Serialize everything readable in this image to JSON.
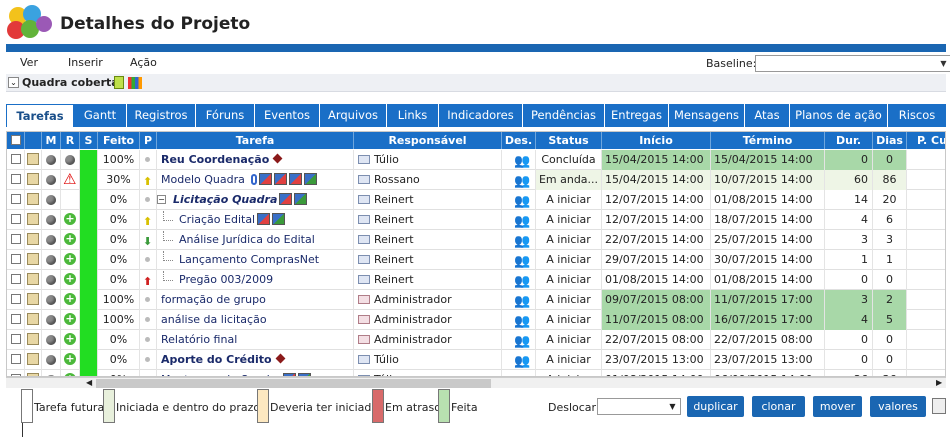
{
  "header": {
    "title": "Detalhes do Projeto"
  },
  "menu": {
    "items": [
      "Ver",
      "Inserir",
      "Ação"
    ],
    "baseline_label": "Baseline:",
    "baseline_value": ""
  },
  "project": {
    "name": "Quadra coberta"
  },
  "tabs": [
    "Tarefas",
    "Gantt",
    "Registros",
    "Fóruns",
    "Eventos",
    "Arquivos",
    "Links",
    "Indicadores",
    "Pendências",
    "Entregas",
    "Mensagens",
    "Atas",
    "Planos de ação",
    "Riscos"
  ],
  "active_tab": "Tarefas",
  "columns": [
    "M",
    "R",
    "S",
    "Feito",
    "P",
    "Tarefa",
    "Responsável",
    "Des.",
    "Status",
    "Início",
    "Término",
    "Dur.",
    "Dias",
    "P. Cu"
  ],
  "rows": [
    {
      "feito": "100%",
      "tarefa": "Reu Coordenação",
      "resp": "Túlio",
      "status": "Concluída",
      "inicio": "15/04/2015 14:00",
      "termino": "15/04/2015 14:00",
      "dur": "0",
      "dias": "0",
      "r": "dot",
      "p": "dot"
    },
    {
      "feito": "30%",
      "tarefa": "Modelo Quadra",
      "resp": "Rossano",
      "status": "Em anda...",
      "inicio": "15/04/2015 14:00",
      "termino": "10/07/2015 14:00",
      "dur": "60",
      "dias": "86",
      "r": "warn",
      "p": "up-yellow"
    },
    {
      "feito": "0%",
      "tarefa": "Licitação Quadra",
      "resp": "Reinert",
      "status": "A iniciar",
      "inicio": "12/07/2015 14:00",
      "termino": "01/08/2015 14:00",
      "dur": "14",
      "dias": "20",
      "r": "none",
      "p": "dot"
    },
    {
      "feito": "0%",
      "tarefa": "Criação Edital",
      "resp": "Reinert",
      "status": "A iniciar",
      "inicio": "12/07/2015 14:00",
      "termino": "18/07/2015 14:00",
      "dur": "4",
      "dias": "6",
      "r": "plus",
      "p": "up-yellow"
    },
    {
      "feito": "0%",
      "tarefa": "Análise Jurídica do Edital",
      "resp": "Reinert",
      "status": "A iniciar",
      "inicio": "22/07/2015 14:00",
      "termino": "25/07/2015 14:00",
      "dur": "3",
      "dias": "3",
      "r": "plus",
      "p": "down-green"
    },
    {
      "feito": "0%",
      "tarefa": "Lançamento ComprasNet",
      "resp": "Reinert",
      "status": "A iniciar",
      "inicio": "29/07/2015 14:00",
      "termino": "30/07/2015 14:00",
      "dur": "1",
      "dias": "1",
      "r": "plus",
      "p": "dot"
    },
    {
      "feito": "0%",
      "tarefa": "Pregão 003/2009",
      "resp": "Reinert",
      "status": "A iniciar",
      "inicio": "01/08/2015 14:00",
      "termino": "01/08/2015 14:00",
      "dur": "0",
      "dias": "0",
      "r": "plus",
      "p": "up-red"
    },
    {
      "feito": "100%",
      "tarefa": "formação de grupo",
      "resp": "Administrador",
      "status": "A iniciar",
      "inicio": "09/07/2015 08:00",
      "termino": "11/07/2015 17:00",
      "dur": "3",
      "dias": "2",
      "r": "plus",
      "p": "dot"
    },
    {
      "feito": "100%",
      "tarefa": "análise da licitação",
      "resp": "Administrador",
      "status": "A iniciar",
      "inicio": "11/07/2015 08:00",
      "termino": "16/07/2015 17:00",
      "dur": "4",
      "dias": "5",
      "r": "plus",
      "p": "dot"
    },
    {
      "feito": "0%",
      "tarefa": "Relatório final",
      "resp": "Administrador",
      "status": "A iniciar",
      "inicio": "22/07/2015 08:00",
      "termino": "22/07/2015 08:00",
      "dur": "0",
      "dias": "0",
      "r": "plus",
      "p": "dot"
    },
    {
      "feito": "0%",
      "tarefa": "Aporte do Crédito",
      "resp": "Túlio",
      "status": "A iniciar",
      "inicio": "23/07/2015 13:00",
      "termino": "23/07/2015 13:00",
      "dur": "0",
      "dias": "0",
      "r": "plus",
      "p": "dot"
    },
    {
      "feito": "0%",
      "tarefa": "Montagem da Quadra",
      "resp": "Túlio",
      "status": "A iniciar",
      "inicio": "01/08/2015 14:00",
      "termino": "06/09/2015 14:00",
      "dur": "26",
      "dias": "36",
      "r": "plus",
      "p": "dot"
    }
  ],
  "legend": [
    "Tarefa futura",
    "Iniciada e dentro do prazo",
    "Deveria ter iniciada",
    "Em atraso",
    "Feita"
  ],
  "legend_colors": [
    "#ffffff",
    "#e8f0dc",
    "#fde8c0",
    "#d86a6a",
    "#b8e0b0"
  ],
  "bottom": {
    "deslocar_label": "Deslocar:",
    "deslocar_value": "",
    "buttons": [
      "duplicar",
      "clonar",
      "mover",
      "valores"
    ]
  }
}
